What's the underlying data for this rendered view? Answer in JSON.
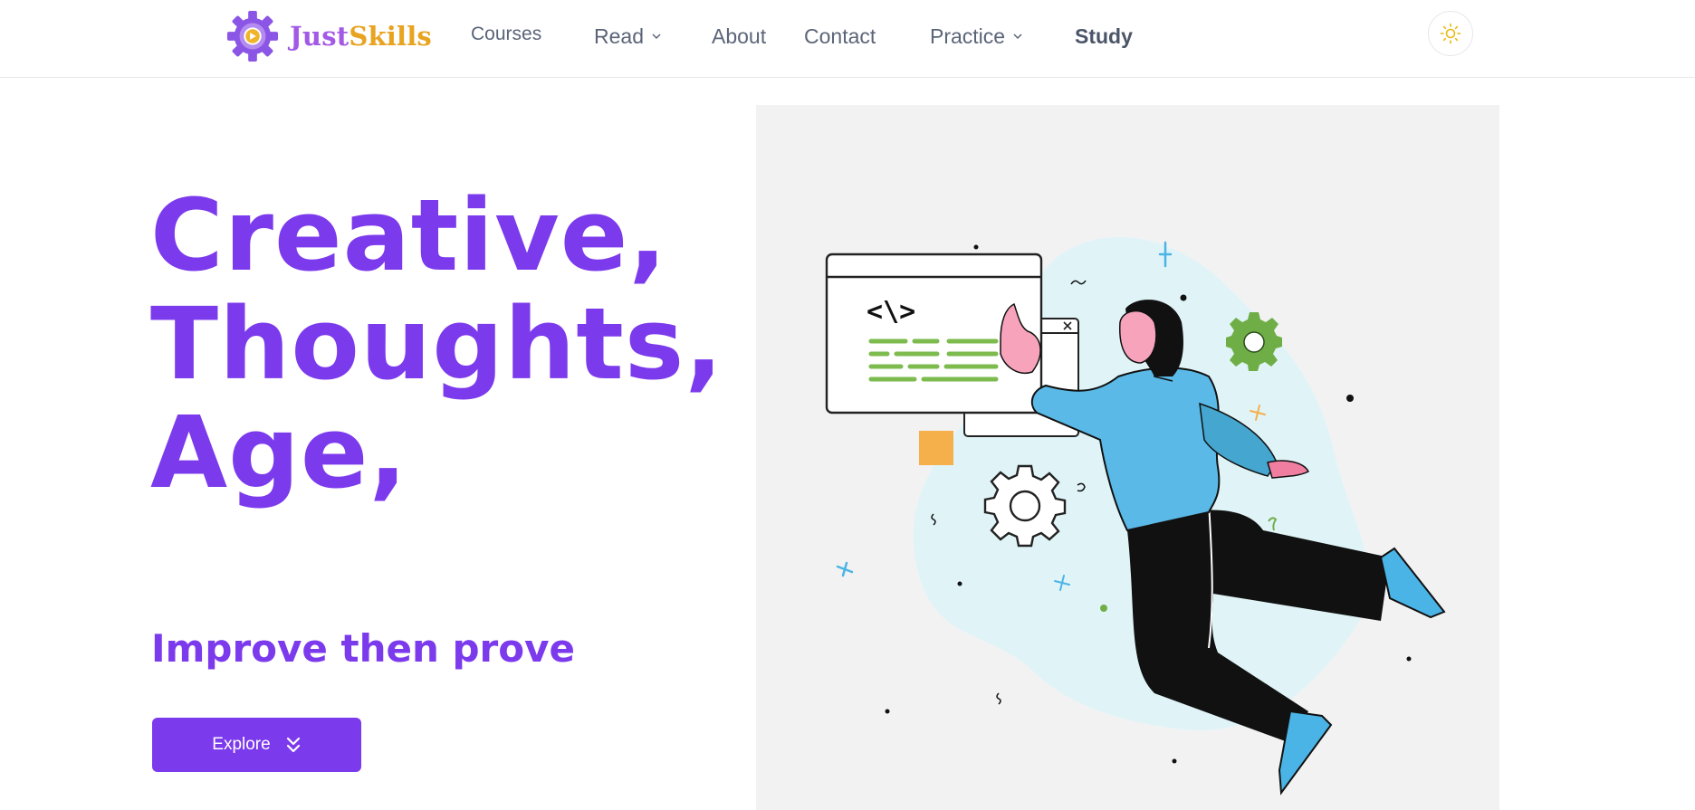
{
  "brand": {
    "part1": "Just",
    "part2": "Skills"
  },
  "nav": {
    "courses": "Courses",
    "read": "Read",
    "about": "About",
    "contact": "Contact",
    "practice": "Practice",
    "study": "Study"
  },
  "hero": {
    "line1": "Creative,",
    "line2": "Thoughts,",
    "line3": "Age,",
    "subtitle": "Improve then prove",
    "cta": "Explore"
  },
  "colors": {
    "primary": "#7c3aed",
    "brand_purple": "#a259e6",
    "brand_gold": "#e8a321",
    "sun": "#e8b90f"
  },
  "icons": {
    "theme": "sun-icon",
    "cta": "double-chevron-down-icon",
    "dropdown": "chevron-down-icon"
  }
}
